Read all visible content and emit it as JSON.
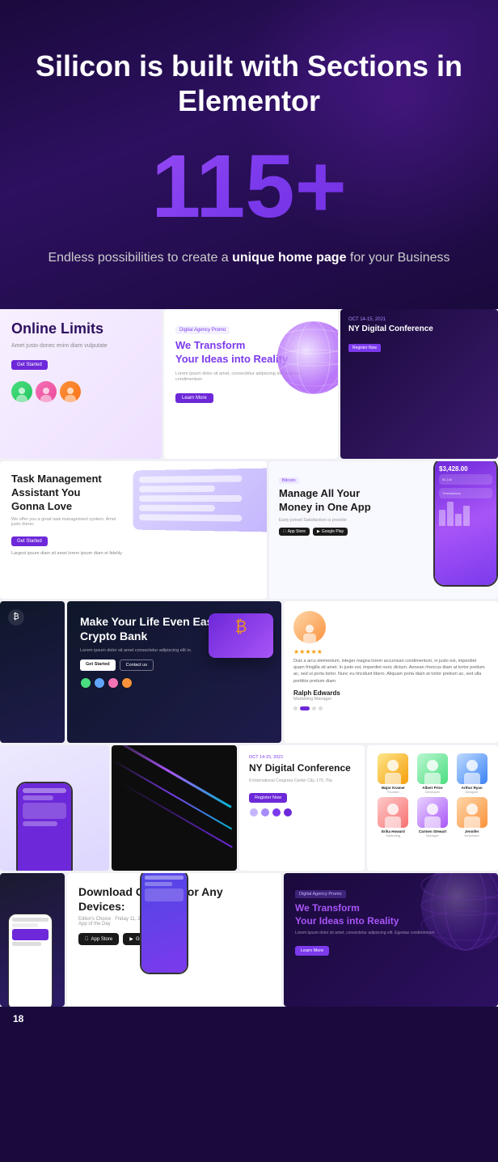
{
  "hero": {
    "title": "Silicon is built with Sections in Elementor",
    "number": "115+",
    "subtext": "Endless possibilities to create a ",
    "subtext_bold": "unique home page",
    "subtext_end": " for your Business"
  },
  "cards": {
    "row1": {
      "online": {
        "title": "Online Limits",
        "subtitle": "Amet justo donec enim diam vulputate",
        "btn": "Get Started"
      },
      "transform": {
        "badge": "Digital Agency Promo",
        "title_1": "We ",
        "title_accent": "Transform",
        "title_2": "Your Ideas into Reality",
        "desc": "Lorem ipsum dolor sit amet, consectetur adipiscing elit. Egestas condimentum",
        "btn": "Learn More"
      },
      "conference": {
        "label": "OCT 14-15, 2021",
        "title": "NY Digital Conference",
        "btn": "Register Now"
      }
    },
    "row2": {
      "task": {
        "title": "Task Management Assistant You Gonna Love",
        "sub": "We offer you a great task management system. Amet justo donec",
        "btn": "Get Started",
        "stat": "Largest ipsum diam sit amet lorem ipsum diam et fidelity"
      },
      "money": {
        "badge": "Bitcoin",
        "title": "Manage All Your Money in One App",
        "sub": "Early joined Satisfaction is provide",
        "appstore": "App Store",
        "googleplay": "Google Play"
      }
    },
    "row3": {
      "crypto": {
        "title": "Make Your Life Even Easier with Crypto Bank",
        "sub": "Lorem ipsum dolor sit amet consectetur adipiscing elit in.",
        "btn1": "Get Started",
        "btn2": "Contact us"
      },
      "testimonial": {
        "name": "Ralph Edwards",
        "role": "Marketing Manager",
        "text": "Duis a arcu elementum, integer magna lorem accumsan condimentum, in justo est, imperdiet quam fringilla sit amet. In justo est, imperdiet nunc dictum. Aenean rhoncus diam at tortor pretium ac, sed ut porta tortor. Nunc eu tincidunt libero. Aliquam porta diam at tortor pretium ac, sed ulla porttitor pretium diam.",
        "stars": "★★★★★"
      }
    },
    "row4": {
      "nyDigital": {
        "date": "OCT 14-15, 2021",
        "title": "NY Digital Conference",
        "sub": "8 International Congress Center City, 170, 70a",
        "btn": "Register Now"
      },
      "team": {
        "members": [
          {
            "name": "Major Kramer",
            "role": "Founder"
          },
          {
            "name": "Albert Price",
            "role": "Developer"
          },
          {
            "name": "Arthur Ryan",
            "role": "Designer"
          },
          {
            "name": "Erika Howard",
            "role": "Marketing"
          },
          {
            "name": "Carmen Stewart",
            "role": "Manager"
          },
          {
            "name": "Jennifer",
            "role": "Developer"
          }
        ]
      }
    },
    "row5": {
      "download": {
        "title": "Download Our App for Any Devices:",
        "device": "Editor's Choice",
        "feature1_label": "Editor's Choice",
        "feature1_val": "Friday 11, 2021",
        "feature2_label": "App of the Day",
        "appstore": "App Store",
        "googleplay": "Google Play"
      },
      "transform2": {
        "badge": "Digital Agency Promo",
        "title_1": "We ",
        "title_accent": "Transform",
        "title_2": "Your Ideas into Reality",
        "desc": "Lorem ipsum dolor sit amet, consectetur adipiscing elit. Egestas condimentum",
        "btn": "Learn More"
      }
    }
  },
  "footer": {
    "page_number": "18"
  }
}
